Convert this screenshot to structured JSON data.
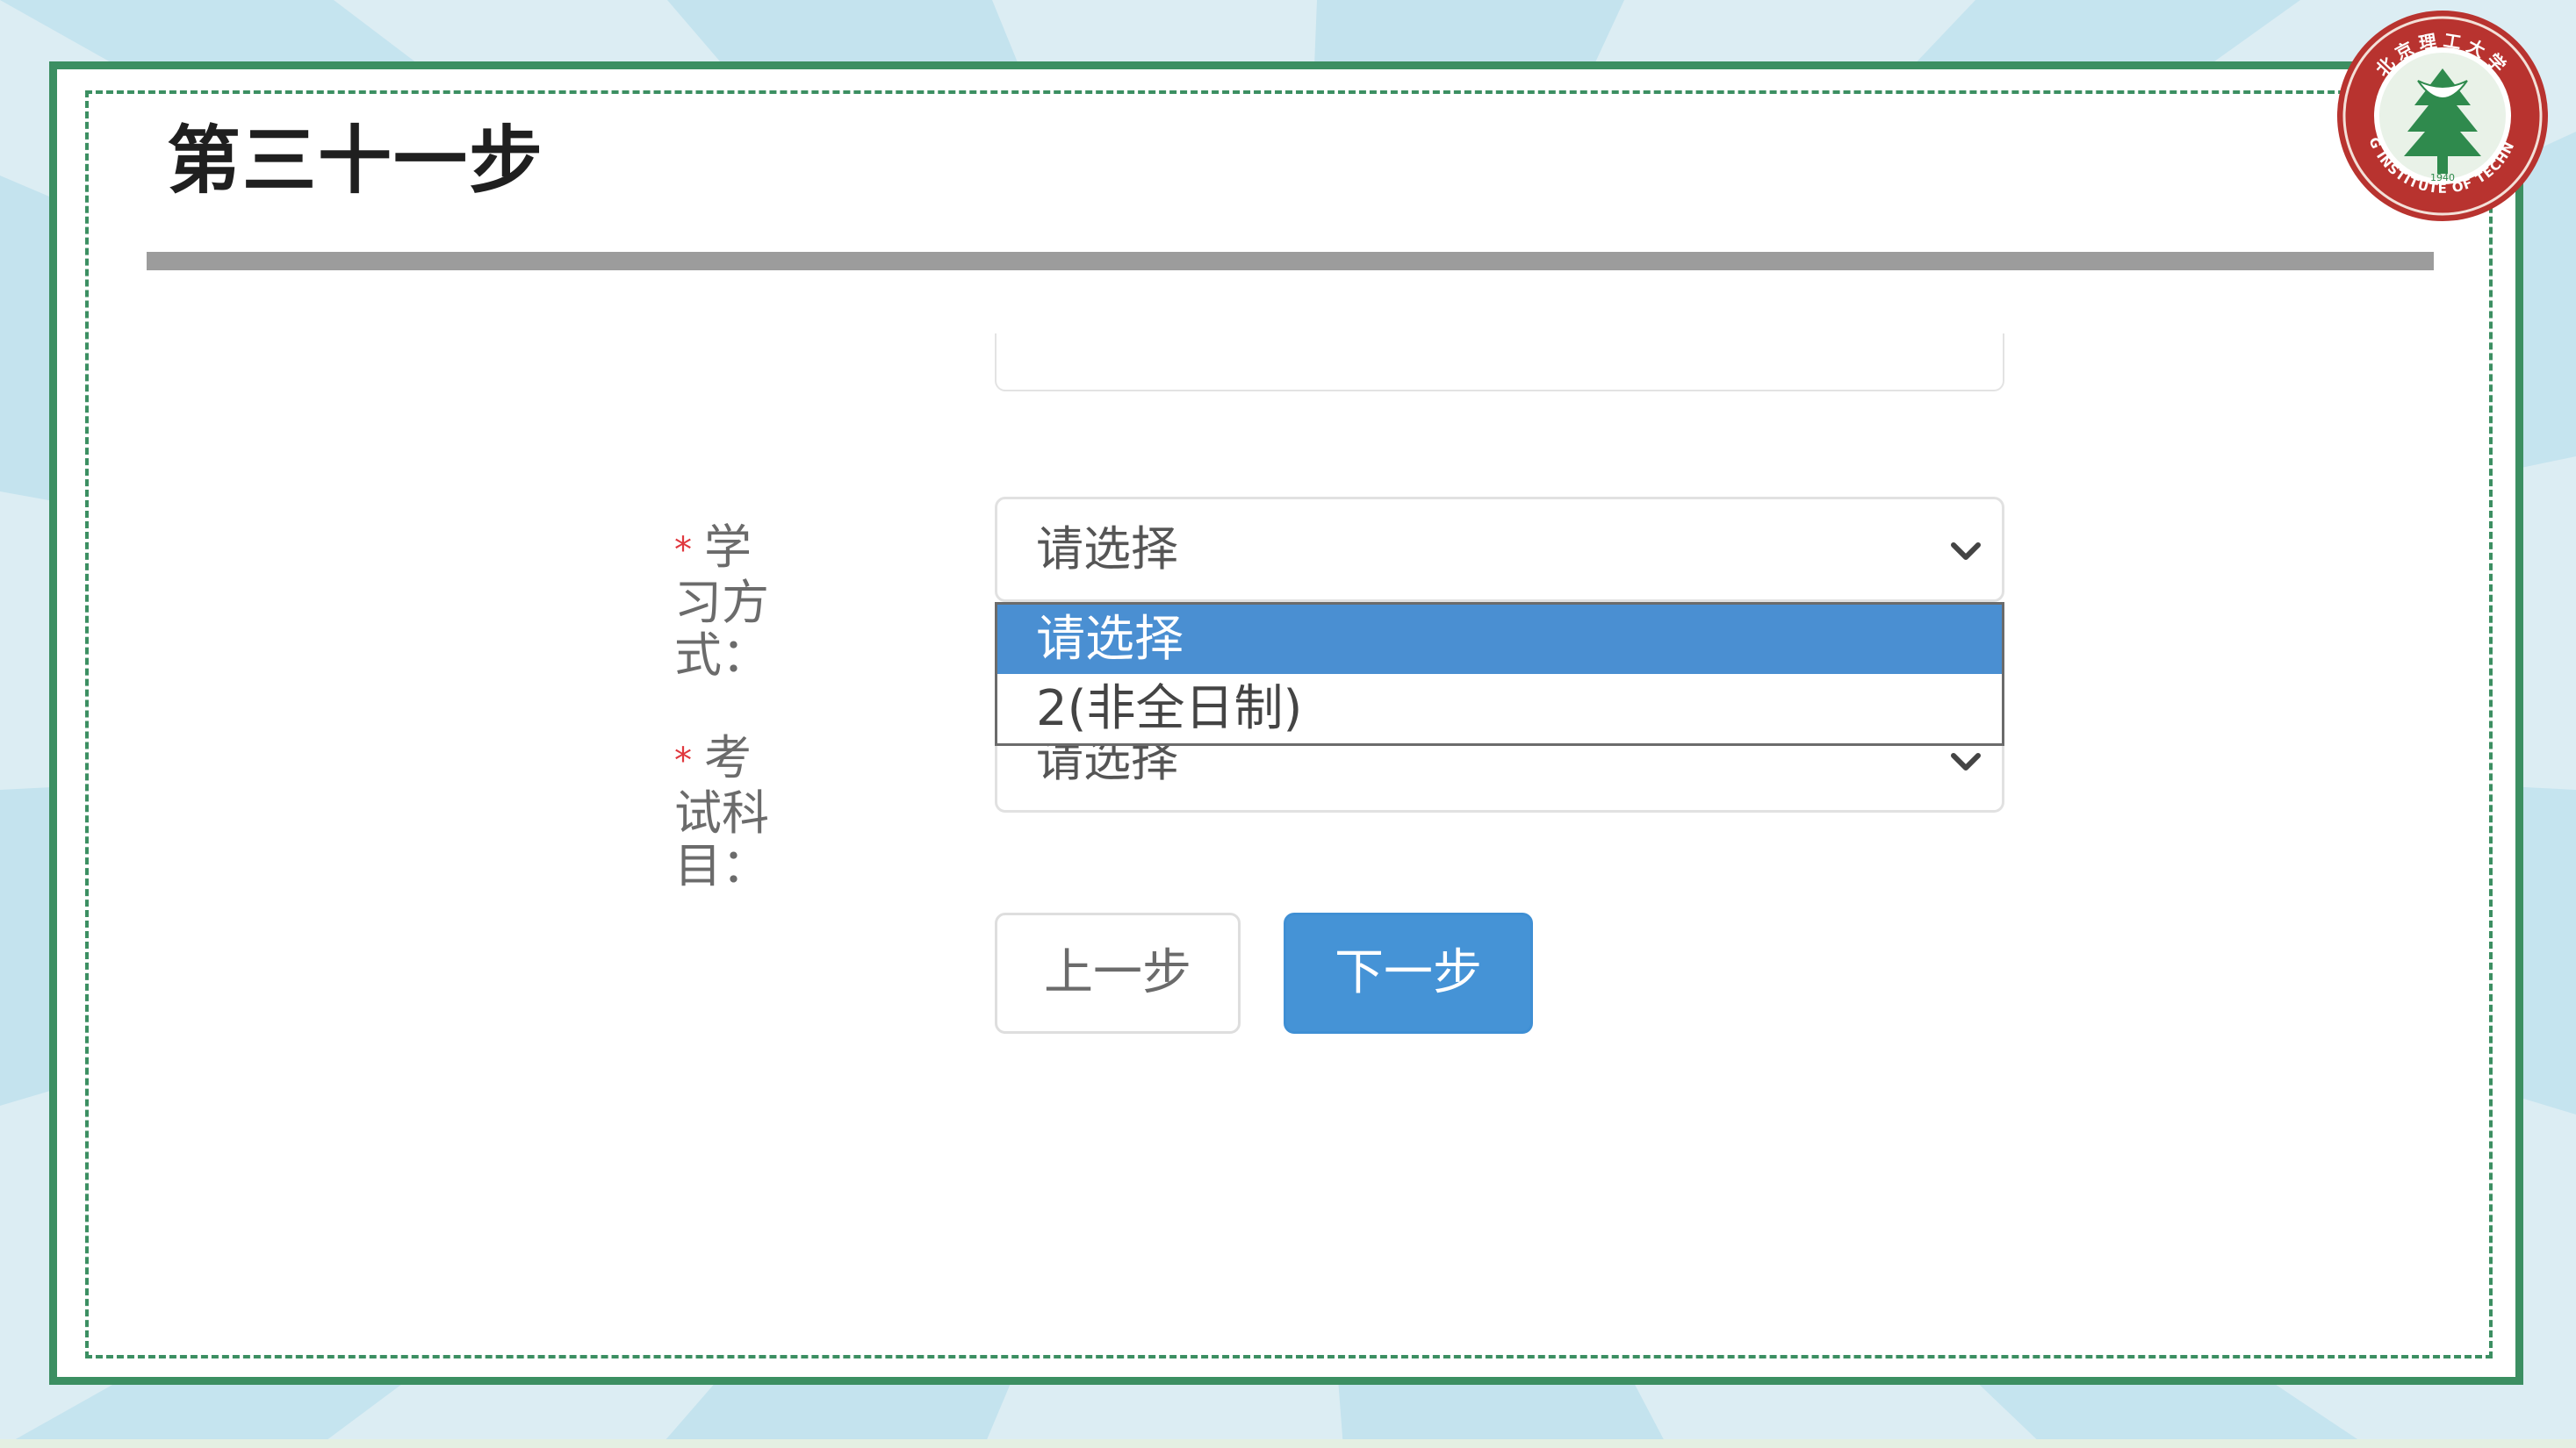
{
  "slide": {
    "title": "第三十一步"
  },
  "logo": {
    "name_cn": "北京理工大学",
    "name_en": "BEIJING INSTITUTE OF TECHNOLOGY",
    "year": "1940"
  },
  "form": {
    "learning_mode": {
      "required_mark": "*",
      "label": "学习方式：",
      "value": "请选择",
      "icon": "chevron-down-icon",
      "options": [
        "请选择",
        "2(非全日制)"
      ],
      "highlighted_option": "请选择"
    },
    "exam_subject": {
      "required_mark": "*",
      "label": "考试科目：",
      "value": "请选择",
      "icon": "chevron-down-icon"
    },
    "buttons": {
      "prev_label": "上一步",
      "next_label": "下一步"
    }
  },
  "colors": {
    "frame_green": "#3c8f62",
    "primary_blue": "#4593d6",
    "option_highlight": "#4a8fd2",
    "required_red": "#e0383e",
    "rule_gray": "#9c9c9c"
  }
}
